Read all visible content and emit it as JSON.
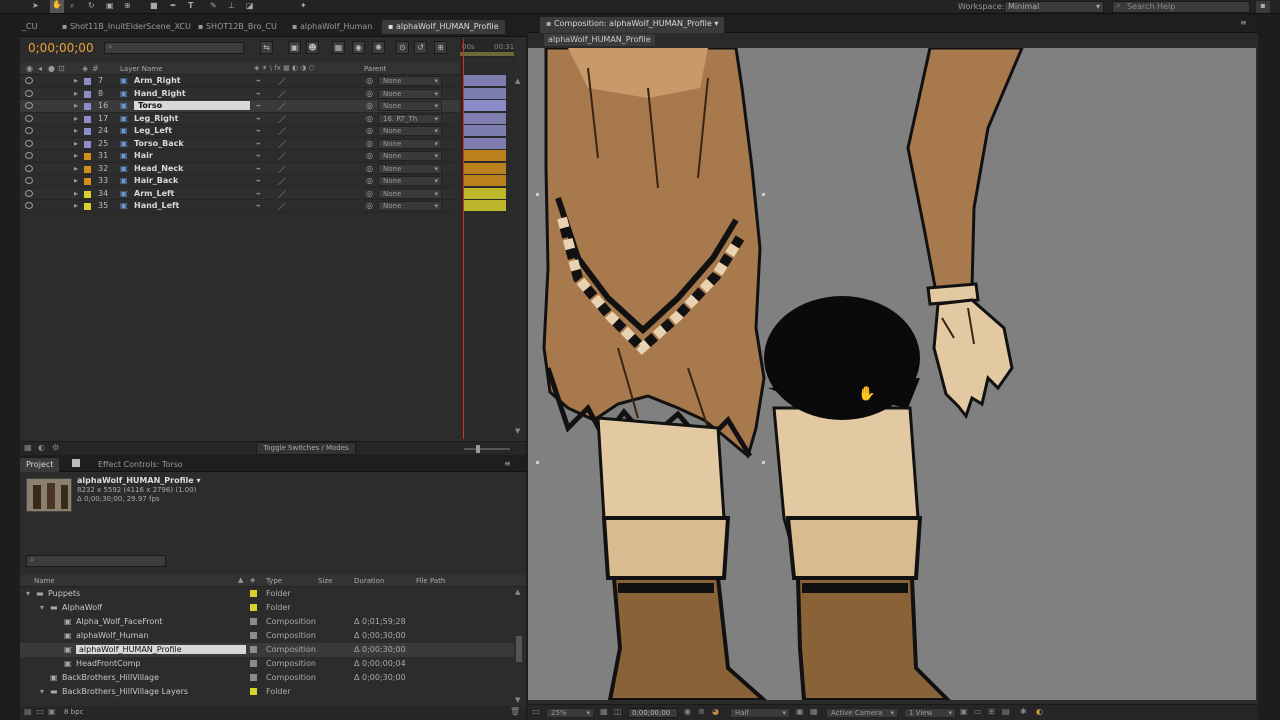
{
  "toolbar": {
    "workspace_label": "Workspace:",
    "workspace_value": "Minimal",
    "search_placeholder": "Search Help"
  },
  "timeline": {
    "tabs": [
      "_CU",
      "Shot11B_InuitElderScene_XCU",
      "SHOT12B_Bro_CU",
      "alphaWolf_Human",
      "alphaWolf_HUMAN_Profile"
    ],
    "active_tab": 4,
    "timecode": "0;00;00;00",
    "search_placeholder": "",
    "col_layer_name": "Layer Name",
    "col_parent": "Parent",
    "ruler_start": "00s",
    "ruler_end": "00:31",
    "layers": [
      {
        "num": "7",
        "name": "Arm_Right",
        "parent": "None",
        "color": "#8c8cc8",
        "selected": false
      },
      {
        "num": "8",
        "name": "Hand_Right",
        "parent": "None",
        "color": "#8c8cc8",
        "selected": false
      },
      {
        "num": "16",
        "name": "Torso",
        "parent": "None",
        "color": "#8c8cc8",
        "selected": true
      },
      {
        "num": "17",
        "name": "Leg_Right",
        "parent": "16. RT_Th",
        "color": "#8c8cc8",
        "selected": false
      },
      {
        "num": "24",
        "name": "Leg_Left",
        "parent": "None",
        "color": "#8c8cc8",
        "selected": false
      },
      {
        "num": "25",
        "name": "Torso_Back",
        "parent": "None",
        "color": "#8c8cc8",
        "selected": false
      },
      {
        "num": "31",
        "name": "Hair",
        "parent": "None",
        "color": "#d4901c",
        "selected": false
      },
      {
        "num": "32",
        "name": "Head_Neck",
        "parent": "None",
        "color": "#d4901c",
        "selected": false
      },
      {
        "num": "33",
        "name": "Hair_Back",
        "parent": "None",
        "color": "#d4901c",
        "selected": false
      },
      {
        "num": "34",
        "name": "Arm_Left",
        "parent": "None",
        "color": "#d8d02c",
        "selected": false
      },
      {
        "num": "35",
        "name": "Hand_Left",
        "parent": "None",
        "color": "#d8d02c",
        "selected": false
      }
    ],
    "toggle_label": "Toggle Switches / Modes"
  },
  "project": {
    "tab_project": "Project",
    "tab_effects": "Effect Controls: Torso",
    "comp_name": "alphaWolf_HUMAN_Profile ▾",
    "comp_size": "8232 x 5592 (4116 x 2796) (1.00)",
    "comp_duration": "Δ 0;00;30;00, 29.97 fps",
    "search_placeholder": "",
    "columns": {
      "name": "Name",
      "type": "Type",
      "size": "Size",
      "duration": "Duration",
      "filepath": "File Path"
    },
    "items": [
      {
        "indent": 0,
        "name": "Puppets",
        "type": "Folder",
        "duration": "",
        "label": "#d8d02c",
        "kind": "folder",
        "selected": false
      },
      {
        "indent": 1,
        "name": "AlphaWolf",
        "type": "Folder",
        "duration": "",
        "label": "#d8d02c",
        "kind": "folder",
        "selected": false
      },
      {
        "indent": 2,
        "name": "Alpha_Wolf_FaceFront",
        "type": "Composition",
        "duration": "Δ 0;01;59;28",
        "label": "#8c8c8c",
        "kind": "comp",
        "selected": false
      },
      {
        "indent": 2,
        "name": "alphaWolf_Human",
        "type": "Composition",
        "duration": "Δ 0;00;30;00",
        "label": "#8c8c8c",
        "kind": "comp",
        "selected": false
      },
      {
        "indent": 2,
        "name": "alphaWolf_HUMAN_Profile",
        "type": "Composition",
        "duration": "Δ 0;00;30;00",
        "label": "#8c8c8c",
        "kind": "comp",
        "selected": true
      },
      {
        "indent": 2,
        "name": "HeadFrontComp",
        "type": "Composition",
        "duration": "Δ 0;00;00;04",
        "label": "#8c8c8c",
        "kind": "comp",
        "selected": false
      },
      {
        "indent": 1,
        "name": "BackBrothers_HillVillage",
        "type": "Composition",
        "duration": "Δ 0;00;30;00",
        "label": "#8c8c8c",
        "kind": "comp",
        "selected": false
      },
      {
        "indent": 1,
        "name": "BackBrothers_HillVillage Layers",
        "type": "Folder",
        "duration": "",
        "label": "#d8d02c",
        "kind": "folder",
        "selected": false
      }
    ],
    "bpc": "8 bpc"
  },
  "composition": {
    "tab_label": "Composition: alphaWolf_HUMAN_Profile",
    "breadcrumb": "alphaWolf_HUMAN_Profile",
    "zoom": "25%",
    "timecode": "0;00;00;00",
    "resolution": "Half",
    "camera": "Active Camera",
    "views": "1 View"
  }
}
